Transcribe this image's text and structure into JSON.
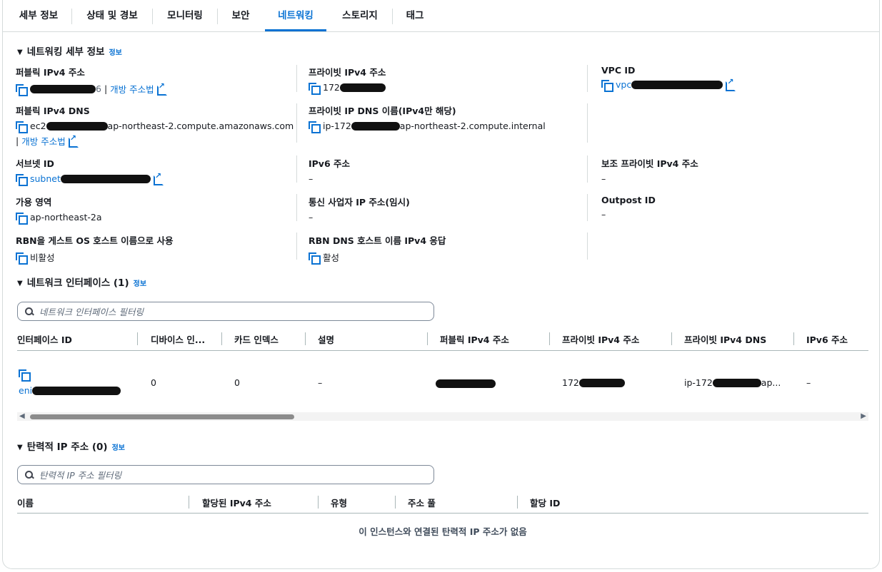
{
  "tabs": [
    "세부 정보",
    "상태 및 경보",
    "모니터링",
    "보안",
    "네트워킹",
    "스토리지",
    "태그"
  ],
  "active_tab": "네트워킹",
  "networking_details": {
    "title": "네트워킹 세부 정보",
    "info": "정보",
    "public_ipv4": {
      "label": "퍼블릭 IPv4 주소",
      "suffix": "6",
      "open_address": "개방 주소법"
    },
    "private_ipv4": {
      "label": "프라이빗 IPv4 주소",
      "value": "172"
    },
    "vpc_id": {
      "label": "VPC ID",
      "value": "vpc"
    },
    "public_dns": {
      "label": "퍼블릭 IPv4 DNS",
      "prefix": "ec2",
      "suffix": "ap-northeast-2.compute.amazonaws.com",
      "open_address": "개방 주소법"
    },
    "private_dns": {
      "label": "프라이빗 IP DNS 이름(IPv4만 해당)",
      "prefix": "ip-172",
      "suffix": "ap-northeast-2.compute.internal"
    },
    "subnet_id": {
      "label": "서브넷 ID",
      "value": "subnet"
    },
    "ipv6": {
      "label": "IPv6 주소",
      "value": "–"
    },
    "secondary_private_ipv4": {
      "label": "보조 프라이빗 IPv4 주소",
      "value": "–"
    },
    "az": {
      "label": "가용 영역",
      "value": "ap-northeast-2a"
    },
    "carrier_ip": {
      "label": "통신 사업자 IP 주소(임시)",
      "value": "–"
    },
    "outpost_id": {
      "label": "Outpost ID",
      "value": "–"
    },
    "rbn_guest": {
      "label": "RBN을 게스트 OS 호스트 이름으로 사용",
      "value": "비활성"
    },
    "rbn_dns": {
      "label": "RBN DNS 호스트 이름 IPv4 응답",
      "value": "활성"
    }
  },
  "network_interfaces": {
    "title": "네트워크 인터페이스 (1)",
    "info": "정보",
    "filter_placeholder": "네트워크 인터페이스 필터링",
    "columns": [
      "인터페이스 ID",
      "디바이스 인...",
      "카드 인덱스",
      "설명",
      "퍼블릭 IPv4 주소",
      "프라이빗 IPv4 주소",
      "프라이빗 IPv4 DNS",
      "IPv6 주소"
    ],
    "row": {
      "id": "eni",
      "device_index": "0",
      "card_index": "0",
      "description": "–",
      "private_ipv4": "172",
      "private_dns_prefix": "ip-172",
      "private_dns_suffix": "ap...",
      "ipv6": "–"
    }
  },
  "elastic_ips": {
    "title": "탄력적 IP 주소 (0)",
    "info": "정보",
    "filter_placeholder": "탄력적 IP 주소 필터링",
    "columns": [
      "이름",
      "할당된 IPv4 주소",
      "유형",
      "주소 풀",
      "할당 ID"
    ],
    "empty": "이 인스턴스와 연결된 탄력적 IP 주소가 없음"
  }
}
